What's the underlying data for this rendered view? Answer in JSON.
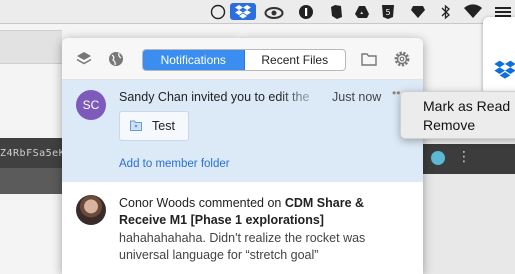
{
  "menubar": {
    "icons": [
      "status-circle-icon",
      "dropbox-icon",
      "creative-cloud-icon",
      "onepassword-icon",
      "evernote-icon",
      "google-drive-icon",
      "html5-icon",
      "sketch-icon",
      "bluetooth-icon",
      "wifi-icon"
    ]
  },
  "background": {
    "code_snippet": "Z4RbFSa5eK"
  },
  "popover": {
    "tabs": {
      "notifications": "Notifications",
      "recent_files": "Recent Files"
    },
    "header_icons": [
      "layers-icon",
      "globe-icon",
      "folder-icon",
      "gear-icon"
    ]
  },
  "notification_1": {
    "avatar_initials": "SC",
    "text": "Sandy Chan invited you to edit the",
    "time": "Just now",
    "file_name": "Test",
    "action_link": "Add to member folder"
  },
  "notification_2": {
    "author": "Conor Woods",
    "verb": "commented on",
    "target": "CDM Share & Receive M1 [Phase 1 explorations]",
    "body": "hahahahahaha. Didn't realize the rocket was universal language for “stretch goal”"
  },
  "context_menu": {
    "mark_as_read": "Mark as Read",
    "remove": "Remove"
  },
  "colors": {
    "accent": "#3b8ef0",
    "highlight_row": "#dce9f7",
    "avatar_sc": "#7e5bbb",
    "link": "#2a6fd1"
  }
}
